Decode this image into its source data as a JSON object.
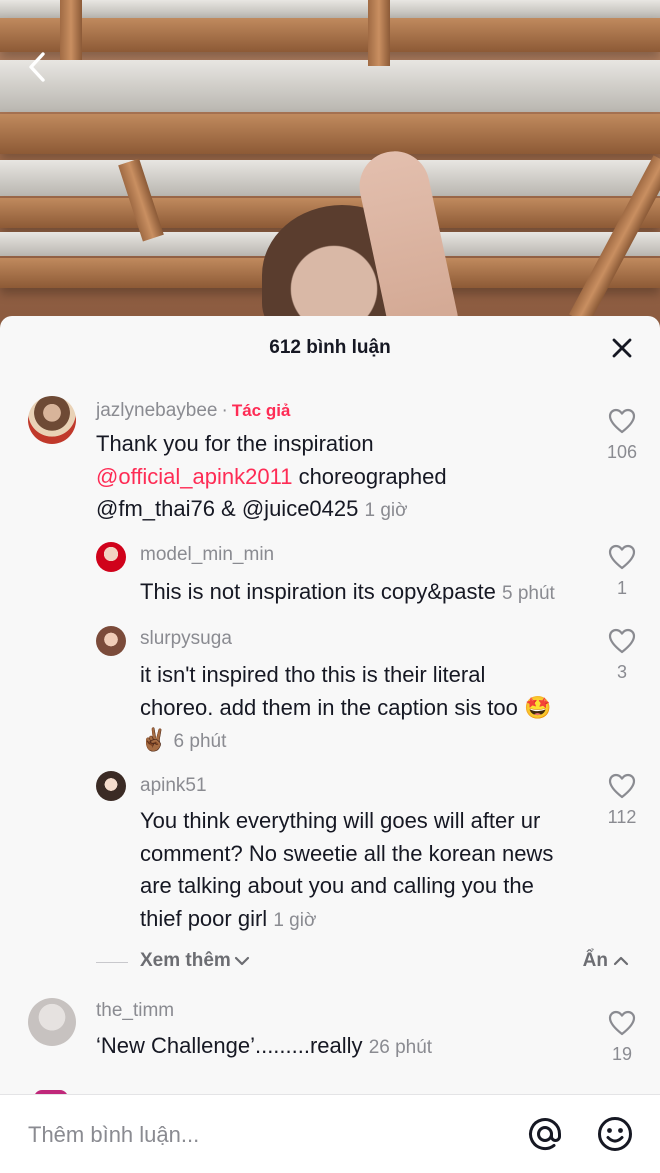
{
  "video": {
    "back_icon": "chevron-left-icon"
  },
  "sheet": {
    "title": "612 bình luận",
    "close_icon": "close-icon"
  },
  "comments": [
    {
      "username": "jazlynebaybee",
      "author_tag": "Tác giả",
      "text_parts": [
        "Thank you for the inspiration",
        "@official_apink2011",
        "choreographed",
        "@fm_thai76 & @juice0425"
      ],
      "time": "1 giờ",
      "likes": "106"
    },
    {
      "username": "model_min_min",
      "text": "This is not inspiration its copy&paste",
      "time": "5 phút",
      "likes": "1"
    },
    {
      "username": "slurpysuga",
      "text_line1": "it isn't inspired tho this is their literal",
      "text_line2": "choreo. add them in the caption sis too",
      "emoji_1": "🤩",
      "emoji_2": "✌🏾",
      "time": "6 phút",
      "likes": "3"
    },
    {
      "username": "apink51",
      "text_line1": "You think everything will goes will after ur",
      "text_line2": "comment? No sweetie all the korean news",
      "text_line3": "are talking about you and calling you the",
      "text_line4": "thief poor girl",
      "time": "1 giờ",
      "likes": "112"
    },
    {
      "username": "the_timm",
      "text": "‘New Challenge’.........really",
      "time": "26 phút",
      "likes": "19"
    }
  ],
  "replies": {
    "more_label": "Xem thêm",
    "hide_label": "Ẩn"
  },
  "input": {
    "placeholder": "Thêm bình luận...",
    "mention_icon": "at-icon",
    "emoji_icon": "emoji-icon"
  },
  "colors": {
    "accent": "#fe2c55",
    "muted": "#8a8b91",
    "sheet_bg": "#f8f8f8"
  }
}
